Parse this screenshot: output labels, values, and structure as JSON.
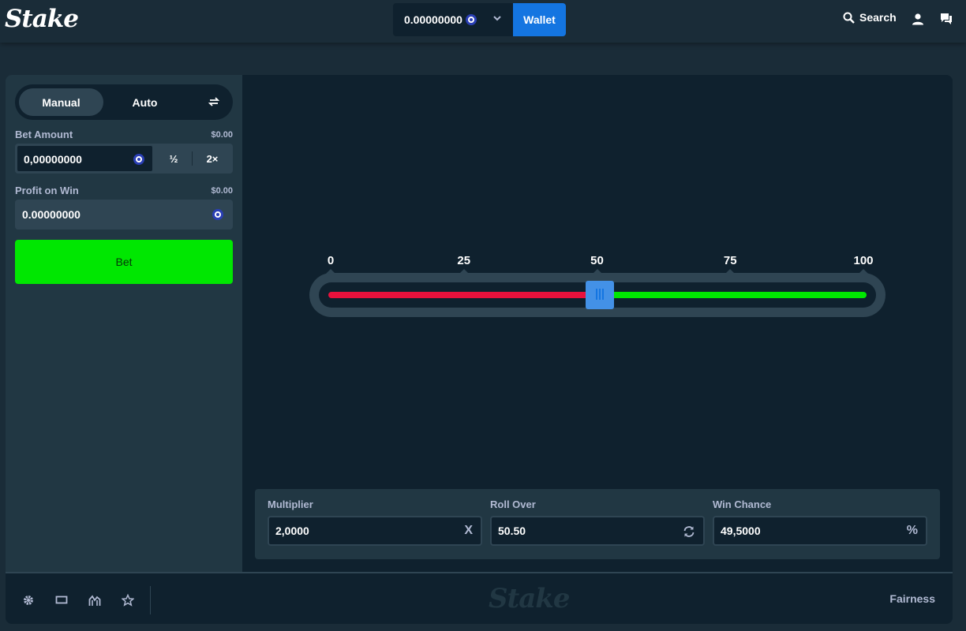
{
  "header": {
    "logo": "Stake",
    "balance": "0.00000000",
    "wallet_label": "Wallet",
    "search_label": "Search"
  },
  "sidebar": {
    "tabs": {
      "manual": "Manual",
      "auto": "Auto"
    },
    "bet_amount": {
      "label": "Bet Amount",
      "usd": "$0.00",
      "value": "0,00000000",
      "half": "½",
      "double": "2×"
    },
    "profit": {
      "label": "Profit on Win",
      "usd": "$0.00",
      "value": "0.00000000"
    },
    "bet_button": "Bet"
  },
  "slider": {
    "ticks": [
      "0",
      "25",
      "50",
      "75",
      "100"
    ],
    "value": 50.5,
    "colors": {
      "lose": "#e9113c",
      "win": "#00e701",
      "handle": "#4391e7"
    }
  },
  "controls": {
    "multiplier": {
      "label": "Multiplier",
      "value": "2,0000",
      "suffix": "X"
    },
    "roll_over": {
      "label": "Roll Over",
      "value": "50.50"
    },
    "win_chance": {
      "label": "Win Chance",
      "value": "49,5000",
      "suffix": "%"
    }
  },
  "footer": {
    "logo": "Stake",
    "fairness": "Fairness",
    "icons": [
      "gear-icon",
      "theatre-mode-icon",
      "stats-icon",
      "star-icon"
    ]
  },
  "colors": {
    "background": "#1a2c38",
    "panel": "#213743",
    "dark": "#0f212e",
    "accent": "#1475e1",
    "bet": "#00e701"
  }
}
